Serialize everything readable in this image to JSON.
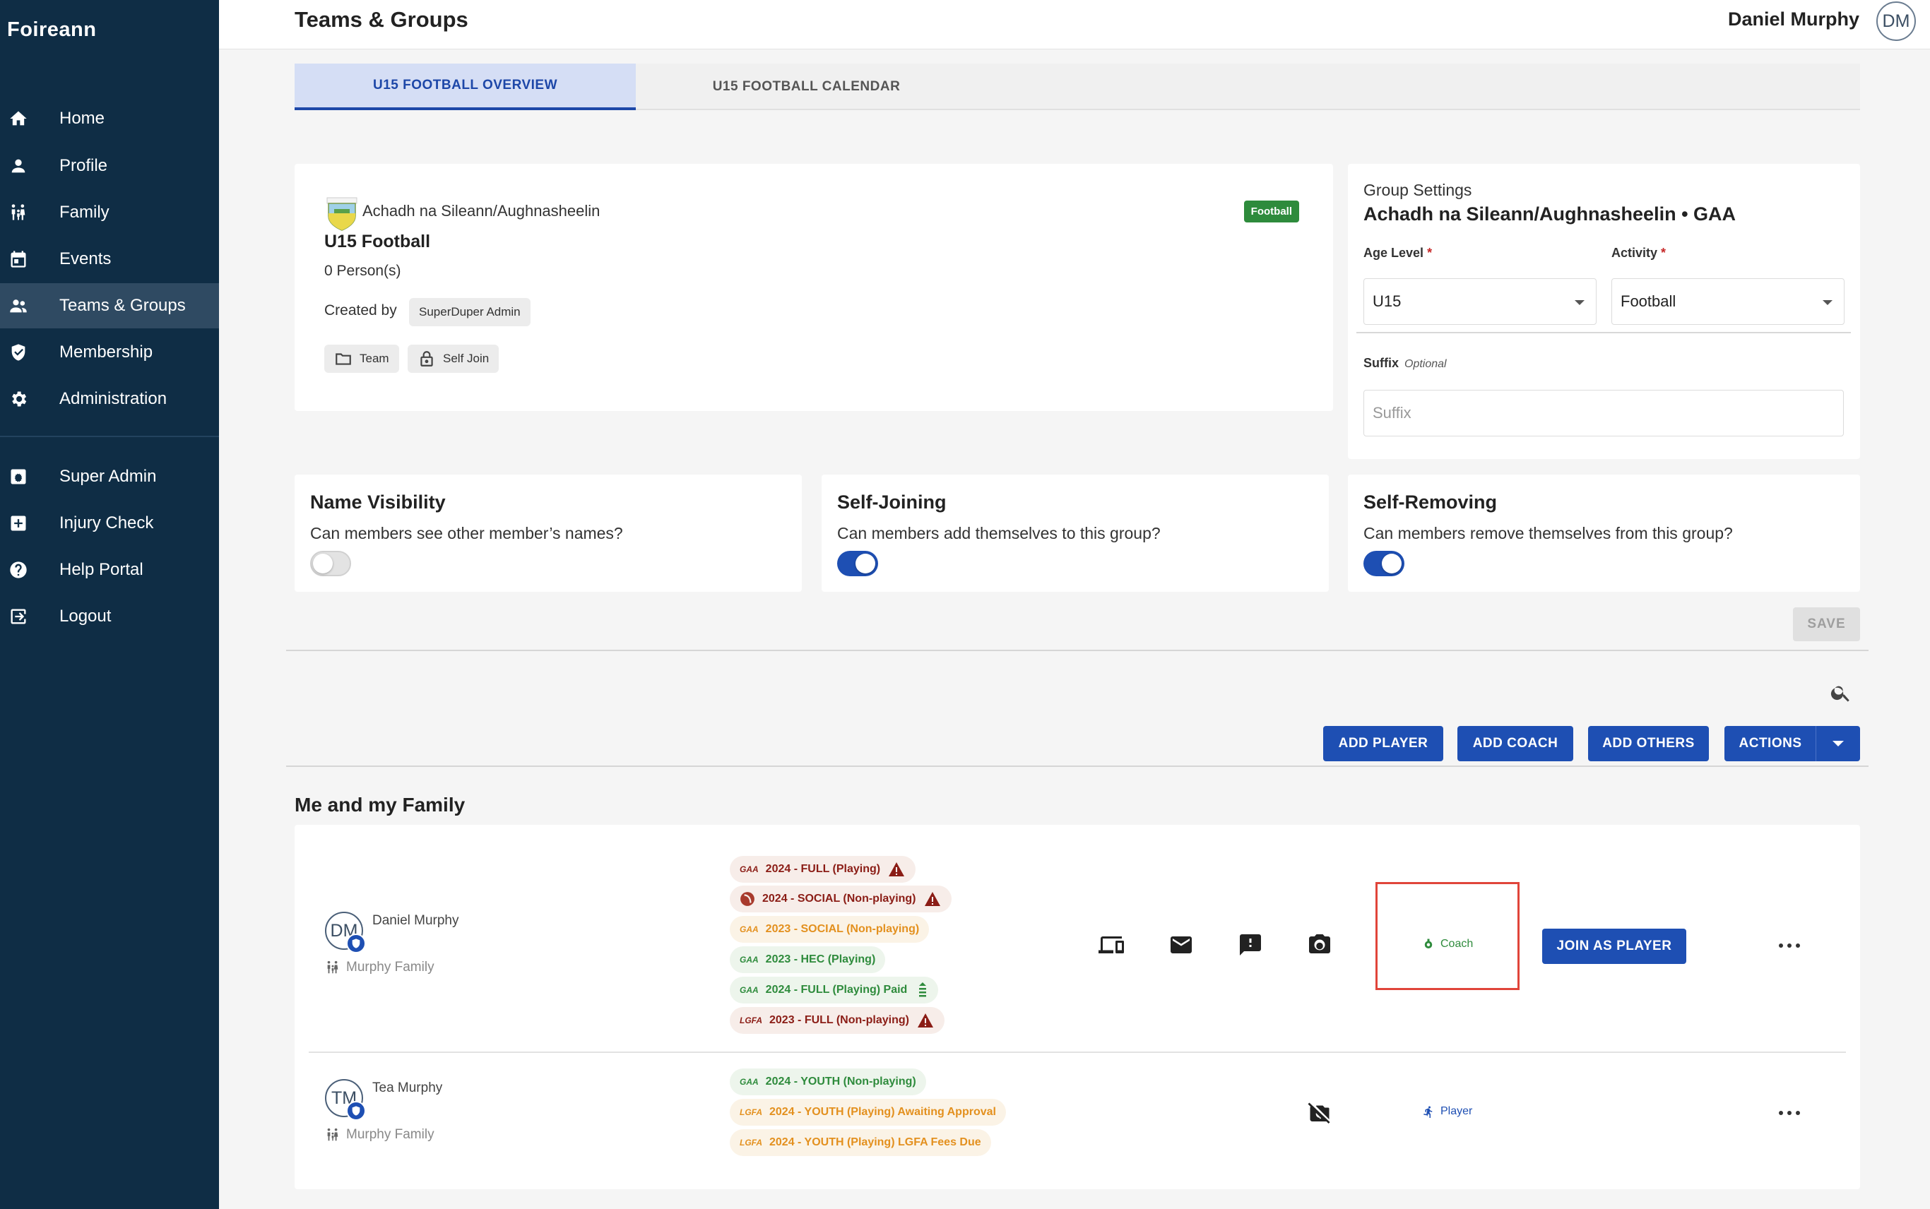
{
  "app": {
    "brand": "Foireann"
  },
  "sidebar": {
    "items": [
      {
        "label": "Home",
        "icon": "home-icon"
      },
      {
        "label": "Profile",
        "icon": "person-icon"
      },
      {
        "label": "Family",
        "icon": "family-icon"
      },
      {
        "label": "Events",
        "icon": "calendar-icon"
      },
      {
        "label": "Teams & Groups",
        "icon": "groups-icon",
        "active": true
      },
      {
        "label": "Membership",
        "icon": "shield-icon"
      },
      {
        "label": "Administration",
        "icon": "gear-icon"
      },
      {
        "label": "Super Admin",
        "icon": "admin-panel-icon"
      },
      {
        "label": "Injury Check",
        "icon": "medical-cross-icon"
      },
      {
        "label": "Help Portal",
        "icon": "help-icon"
      },
      {
        "label": "Logout",
        "icon": "logout-icon"
      }
    ]
  },
  "header": {
    "title": "Teams & Groups",
    "user_name": "Daniel Murphy",
    "user_initials": "DM"
  },
  "tabs": [
    {
      "label": "U15 FOOTBALL OVERVIEW",
      "active": true
    },
    {
      "label": "U15 FOOTBALL CALENDAR",
      "active": false
    }
  ],
  "group": {
    "club_name": "Achadh na Sileann/Aughnasheelin",
    "name": "U15 Football",
    "persons": "0 Person(s)",
    "created_by_label": "Created by",
    "created_by": "SuperDuper Admin",
    "type_chip": "Team",
    "join_chip": "Self Join",
    "sport_badge": "Football"
  },
  "settings": {
    "label": "Group Settings",
    "club_line": "Achadh na Sileann/Aughnasheelin • GAA",
    "age_level_label": "Age Level",
    "age_level_value": "U15",
    "activity_label": "Activity",
    "activity_value": "Football",
    "required_mark": "*",
    "suffix_label": "Suffix",
    "suffix_optional": "Optional",
    "suffix_placeholder": "Suffix"
  },
  "toggles": [
    {
      "title": "Name Visibility",
      "desc": "Can members see other member’s names?",
      "on": false
    },
    {
      "title": "Self-Joining",
      "desc": "Can members add themselves to this group?",
      "on": true
    },
    {
      "title": "Self-Removing",
      "desc": "Can members remove themselves from this group?",
      "on": true
    }
  ],
  "buttons": {
    "save": "SAVE",
    "add_player": "ADD PLAYER",
    "add_coach": "ADD COACH",
    "add_others": "ADD OTHERS",
    "actions": "ACTIONS",
    "join_as_player": "JOIN AS PLAYER"
  },
  "family_section": {
    "title": "Me and my Family"
  },
  "members": [
    {
      "name": "Daniel Murphy",
      "initials": "DM",
      "family": "Murphy Family",
      "role": "Coach",
      "memberships": [
        {
          "org": "GAA",
          "label": "2024 - FULL (Playing)",
          "color": "red",
          "flag": "warning"
        },
        {
          "org": "crest",
          "label": "2024 - SOCIAL (Non-playing)",
          "color": "red",
          "flag": "warning"
        },
        {
          "org": "GAA",
          "label": "2023 - SOCIAL (Non-playing)",
          "color": "orange",
          "flag": ""
        },
        {
          "org": "GAA",
          "label": "2023 - HEC (Playing)",
          "color": "green",
          "flag": ""
        },
        {
          "org": "GAA",
          "label": "2024 - FULL (Playing) Paid",
          "color": "green",
          "flag": "paid"
        },
        {
          "org": "LGFA",
          "label": "2023 - FULL (Non-playing)",
          "color": "red",
          "flag": "warning"
        }
      ]
    },
    {
      "name": "Tea Murphy",
      "initials": "TM",
      "family": "Murphy Family",
      "role": "Player",
      "memberships": [
        {
          "org": "GAA",
          "label": "2024 - YOUTH (Non-playing)",
          "color": "green",
          "flag": ""
        },
        {
          "org": "LGFA",
          "label": "2024 - YOUTH (Playing) Awaiting Approval",
          "color": "orange",
          "flag": ""
        },
        {
          "org": "LGFA",
          "label": "2024 - YOUTH (Playing) LGFA Fees Due",
          "color": "orange",
          "flag": ""
        }
      ]
    }
  ],
  "colors": {
    "sidebar": "#0f2d45",
    "primary": "#1e4fb3",
    "green": "#2e8b3c",
    "red": "#8b1d16",
    "orange": "#e3901e",
    "highlight": "#e0453a"
  }
}
